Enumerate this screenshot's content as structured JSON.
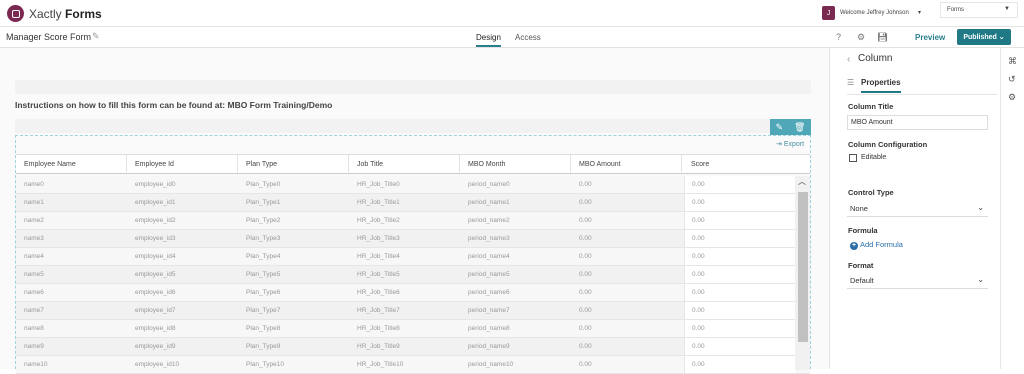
{
  "app": {
    "name_prefix": "Xactly",
    "name_bold": "Forms",
    "welcome": "Welcome Jeffrey Johnson",
    "avatar_initial": "J",
    "forms_select": "Forms"
  },
  "form": {
    "title": "Manager Score Form",
    "tabs": [
      "Design",
      "Access"
    ],
    "preview": "Preview",
    "published": "Published"
  },
  "content": {
    "instructions": "Instructions on how to fill this form can be found at: MBO Form Training/Demo",
    "export": "Export"
  },
  "table": {
    "columns": [
      "Employee Name",
      "Employee Id",
      "Plan Type",
      "Job Title",
      "MBO Month",
      "MBO Amount",
      "Score"
    ],
    "rows": [
      [
        "name0",
        "employee_id0",
        "Plan_Type0",
        "HR_Job_Title0",
        "period_name0",
        "0.00",
        "0.00"
      ],
      [
        "name1",
        "employee_id1",
        "Plan_Type1",
        "HR_Job_Title1",
        "period_name1",
        "0.00",
        "0.00"
      ],
      [
        "name2",
        "employee_id2",
        "Plan_Type2",
        "HR_Job_Title2",
        "period_name2",
        "0.00",
        "0.00"
      ],
      [
        "name3",
        "employee_id3",
        "Plan_Type3",
        "HR_Job_Title3",
        "period_name3",
        "0.00",
        "0.00"
      ],
      [
        "name4",
        "employee_id4",
        "Plan_Type4",
        "HR_Job_Title4",
        "period_name4",
        "0.00",
        "0.00"
      ],
      [
        "name5",
        "employee_id5",
        "Plan_Type5",
        "HR_Job_Title5",
        "period_name5",
        "0.00",
        "0.00"
      ],
      [
        "name6",
        "employee_id6",
        "Plan_Type6",
        "HR_Job_Title6",
        "period_name6",
        "0.00",
        "0.00"
      ],
      [
        "name7",
        "employee_id7",
        "Plan_Type7",
        "HR_Job_Title7",
        "period_name7",
        "0.00",
        "0.00"
      ],
      [
        "name8",
        "employee_id8",
        "Plan_Type8",
        "HR_Job_Title8",
        "period_name8",
        "0.00",
        "0.00"
      ],
      [
        "name9",
        "employee_id9",
        "Plan_Type9",
        "HR_Job_Title9",
        "period_name9",
        "0.00",
        "0.00"
      ],
      [
        "name10",
        "employee_id10",
        "Plan_Type10",
        "HR_Job_Title10",
        "period_name10",
        "0.00",
        "0.00"
      ]
    ]
  },
  "panel": {
    "title": "Column",
    "tab": "Properties",
    "column_title_label": "Column Title",
    "column_title_value": "MBO Amount",
    "config_label": "Column Configuration",
    "editable_label": "Editable",
    "control_type_label": "Control Type",
    "control_type_value": "None",
    "formula_label": "Formula",
    "add_formula": "Add Formula",
    "format_label": "Format",
    "format_value": "Default"
  },
  "colors": {
    "accent": "#1f7a86",
    "brand": "#7a2951"
  }
}
